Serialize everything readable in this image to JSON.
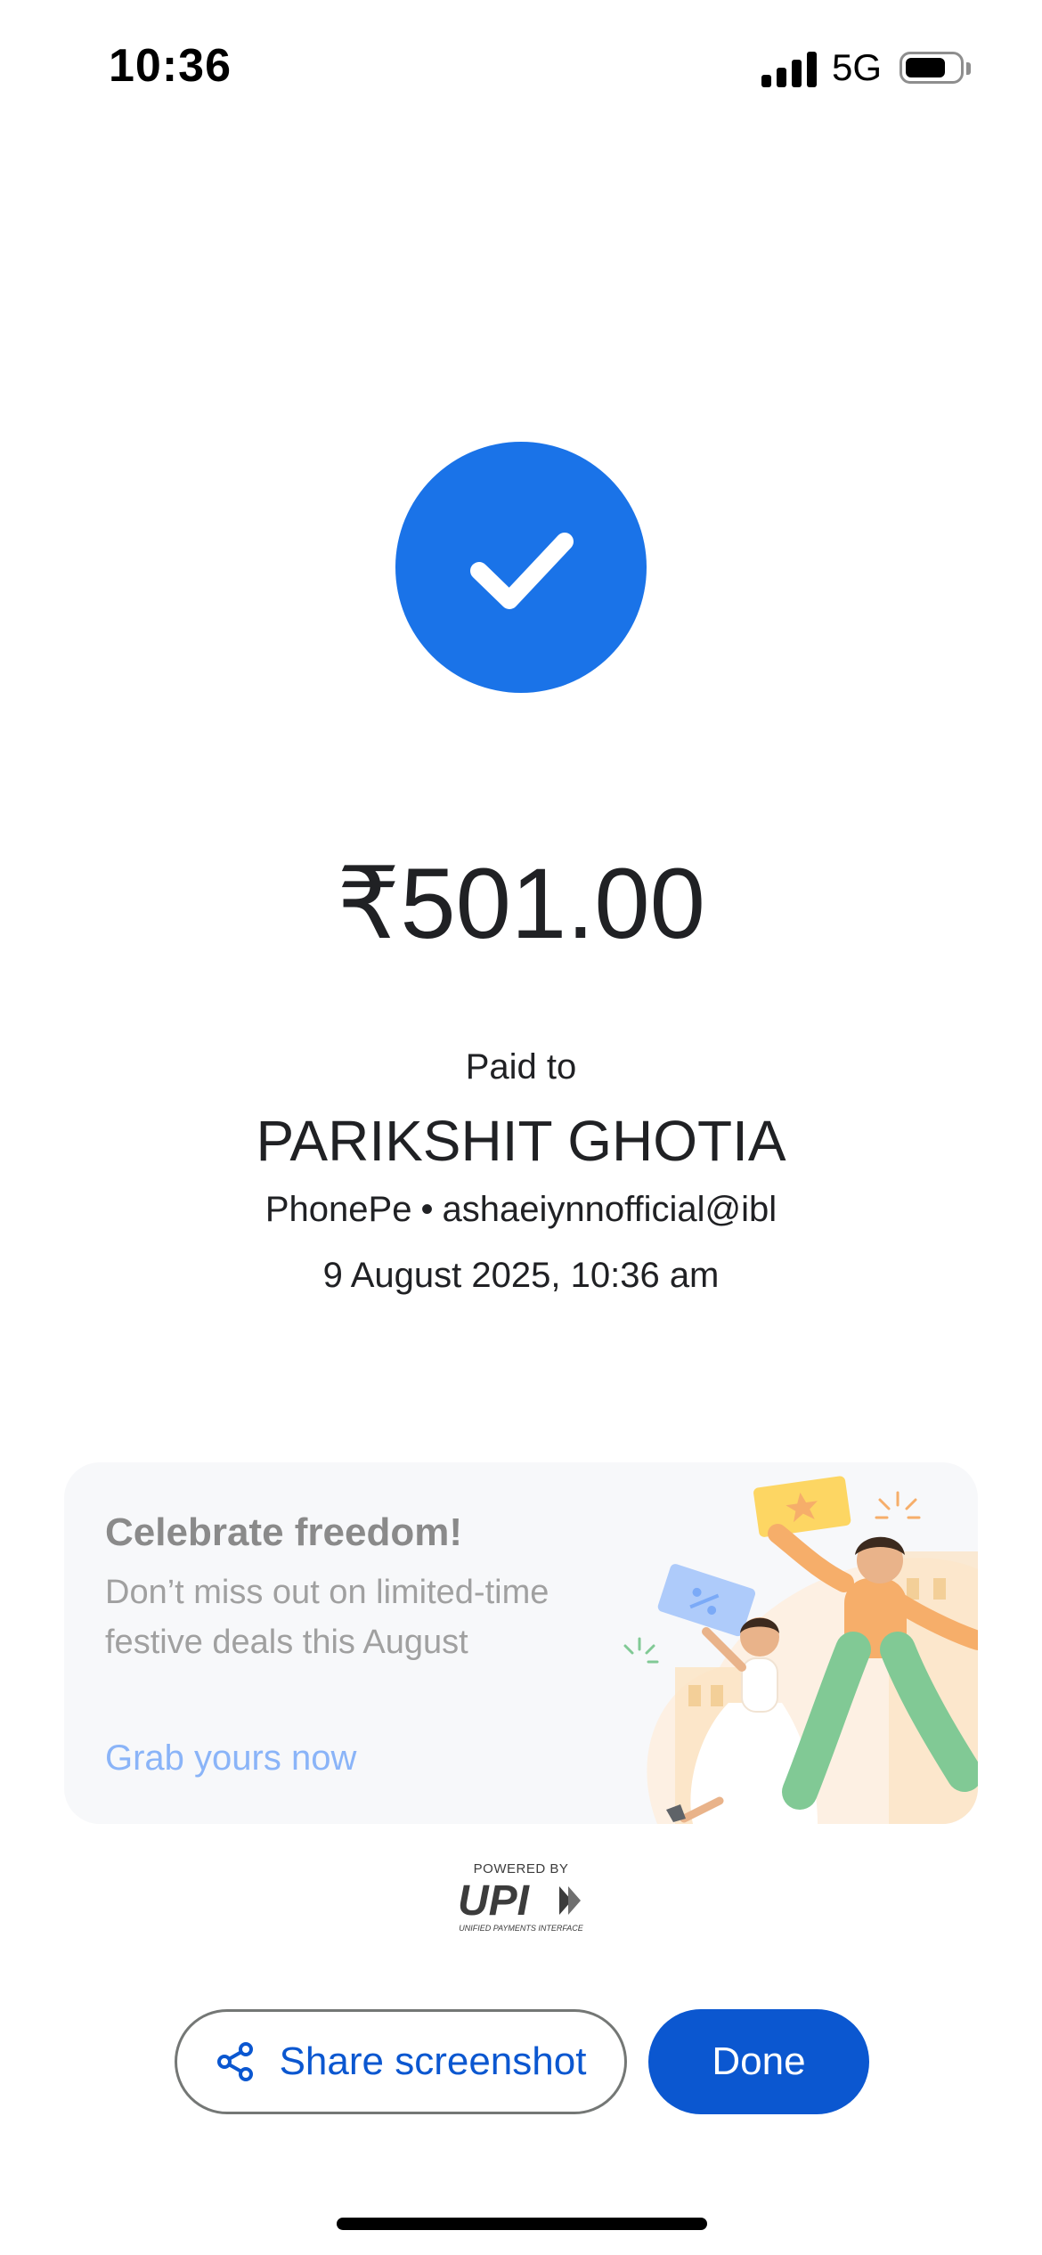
{
  "status_bar": {
    "time": "10:36",
    "network": "5G",
    "signal_icon": "signal-bars-icon",
    "battery_icon": "battery-icon",
    "battery_level": 0.76
  },
  "payment": {
    "success_icon": "checkmark-icon",
    "amount": "₹501.00",
    "paid_to_label": "Paid to",
    "payee_name": "PARIKSHIT GHOTIA",
    "app_name": "PhonePe",
    "separator": "•",
    "upi_id": "ashaeiynnofficial@ibl",
    "timestamp": "9 August 2025, 10:36 am"
  },
  "promo": {
    "title": "Celebrate freedom!",
    "description": "Don’t miss out on limited-time festive deals this August",
    "link_label": "Grab yours now",
    "illustration": "festive-celebration-illustration"
  },
  "upi_badge": {
    "powered_by": "POWERED BY",
    "logo_text": "UPI",
    "subtitle": "UNIFIED PAYMENTS INTERFACE"
  },
  "actions": {
    "share_label": "Share screenshot",
    "share_icon": "share-icon",
    "done_label": "Done"
  },
  "colors": {
    "primary": "#1a73e8",
    "button_primary": "#0b57d0",
    "link_faded": "#8ab4f8",
    "card_bg": "#f7f8fa"
  }
}
